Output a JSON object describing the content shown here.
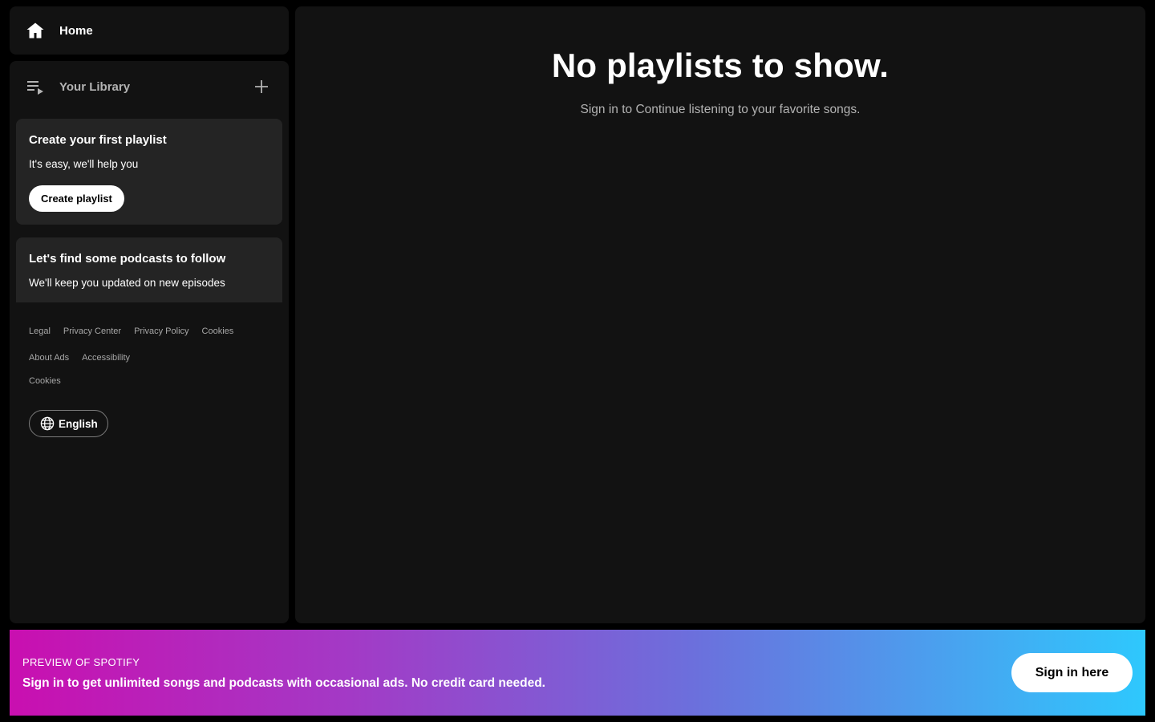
{
  "nav": {
    "home_label": "Home",
    "home_icon": "home-icon"
  },
  "library": {
    "title": "Your Library",
    "library_icon": "library-icon",
    "add_icon": "plus-icon",
    "cards": [
      {
        "title": "Create your first playlist",
        "text": "It's easy, we'll help you",
        "button": "Create playlist"
      },
      {
        "title": "Let's find some podcasts to follow",
        "text": "We'll keep you updated on new episodes"
      }
    ],
    "footer_links": [
      "Legal",
      "Privacy Center",
      "Privacy Policy",
      "Cookies",
      "About Ads",
      "Accessibility",
      "Cookies"
    ],
    "language_label": "English",
    "language_icon": "globe-icon"
  },
  "main": {
    "heading": "No playlists to show.",
    "subtext": "Sign in to Continue listening to your favorite songs."
  },
  "banner": {
    "eyebrow": "PREVIEW OF SPOTIFY",
    "message": "Sign in to get unlimited songs and podcasts with occasional ads. No credit card needed.",
    "button": "Sign in here"
  },
  "colors": {
    "background": "#000000",
    "panel": "#121212",
    "card": "#242424",
    "muted_text": "#b3b3b3",
    "gradient_start": "#c90fb0",
    "gradient_end": "#2ec8fd"
  }
}
